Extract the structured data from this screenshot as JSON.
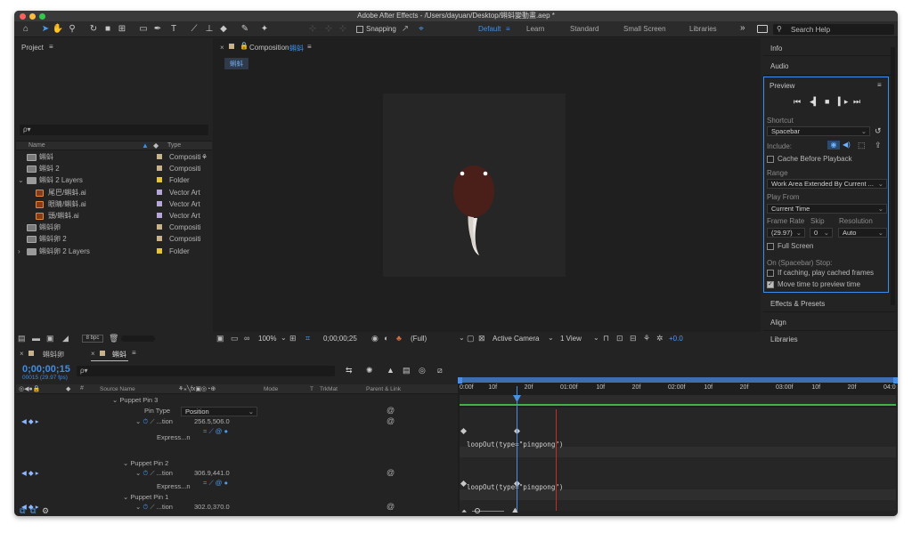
{
  "window": {
    "title": "Adobe After Effects - /Users/dayuan/Desktop/蝌蚪變動畫.aep *"
  },
  "toolbar": {
    "snapping_label": "Snapping",
    "workspaces": [
      "Default",
      "Learn",
      "Standard",
      "Small Screen",
      "Libraries"
    ],
    "active_workspace": "Default",
    "more_label": "»",
    "search_placeholder": "Search Help"
  },
  "project": {
    "title": "Project",
    "menu_icon": "≡",
    "search_prefix": "ρ▾",
    "col_name": "Name",
    "col_type": "Type",
    "items": [
      {
        "name": "蝌蚪",
        "type": "Compositi",
        "kind": "comp",
        "swatch": "#c9b38a"
      },
      {
        "name": "蝌蚪 2",
        "type": "Compositi",
        "kind": "comp",
        "swatch": "#c9b38a"
      },
      {
        "name": "蝌蚪 2 Layers",
        "type": "Folder",
        "kind": "folder",
        "swatch": "#e3c43a",
        "expanded": true
      },
      {
        "name": "尾巴/蝌蚪.ai",
        "type": "Vector Art",
        "kind": "ai",
        "swatch": "#b7a6d9",
        "indent": 1
      },
      {
        "name": "眼睛/蝌蚪.ai",
        "type": "Vector Art",
        "kind": "ai",
        "swatch": "#b7a6d9",
        "indent": 1
      },
      {
        "name": "頭/蝌蚪.ai",
        "type": "Vector Art",
        "kind": "ai",
        "swatch": "#b7a6d9",
        "indent": 1
      },
      {
        "name": "蝌蚪卵",
        "type": "Compositi",
        "kind": "comp",
        "swatch": "#c9b38a"
      },
      {
        "name": "蝌蚪卵 2",
        "type": "Compositi",
        "kind": "comp",
        "swatch": "#c9b38a"
      },
      {
        "name": "蝌蚪卵 2 Layers",
        "type": "Folder",
        "kind": "folder",
        "swatch": "#e3c43a"
      }
    ],
    "bpc_label": "8 bpc"
  },
  "composition": {
    "title": "Composition",
    "name": "蝌蚪",
    "tab_label": "蝌蚪",
    "zoom": "100%",
    "timecode": "0;00;00;25",
    "resolution": "(Full)",
    "camera": "Active Camera",
    "view": "1 View",
    "exposure": "+0.0"
  },
  "right_panels": {
    "info": "Info",
    "audio": "Audio",
    "preview": {
      "title": "Preview",
      "shortcut_label": "Shortcut",
      "shortcut_value": "Spacebar",
      "include_label": "Include:",
      "cache_label": "Cache Before Playback",
      "range_label": "Range",
      "range_value": "Work Area Extended By Current ...",
      "play_from_label": "Play From",
      "play_from_value": "Current Time",
      "frame_rate_label": "Frame Rate",
      "skip_label": "Skip",
      "resolution_label": "Resolution",
      "frame_rate_value": "(29.97)",
      "skip_value": "0",
      "resolution_value": "Auto",
      "full_screen_label": "Full Screen",
      "stop_label": "On (Spacebar) Stop:",
      "if_caching_label": "If caching, play cached frames",
      "move_time_label": "Move time to preview time",
      "move_time_checked": true
    },
    "effects": "Effects & Presets",
    "align": "Align",
    "libraries": "Libraries"
  },
  "timeline": {
    "tabs": [
      {
        "label": "蝌蚪卵",
        "active": false
      },
      {
        "label": "蝌蚪",
        "active": true
      }
    ],
    "timecode": "0;00;00;15",
    "frame_info": "00015 (29.97 fps)",
    "col_source": "Source Name",
    "col_mode": "Mode",
    "col_t": "T",
    "col_trkmat": "TrkMat",
    "col_parent": "Parent & Link",
    "ruler_labels": [
      "0:00f",
      "10f",
      "20f",
      "01:00f",
      "10f",
      "20f",
      "02:00f",
      "10f",
      "20f",
      "03:00f",
      "10f",
      "20f",
      "04:0"
    ],
    "layers": [
      {
        "label": "Puppet Pin 3",
        "pin_type_label": "Pin Type",
        "pin_type_value": "Position",
        "prop_label": "...tion",
        "value": "256.5,506.0",
        "expr_label": "Express...n",
        "expression": "loopOut(type=\"pingpong\")"
      },
      {
        "label": "Puppet Pin 2",
        "prop_label": "...tion",
        "value": "306.9,441.0",
        "expr_label": "Express...n",
        "expression": "loopOut(type=\"pingpong\")"
      },
      {
        "label": "Puppet Pin 1",
        "prop_label": "...tion",
        "value": "302.0,370.0"
      }
    ]
  },
  "colors": {
    "accent": "#3d8ee8",
    "value_red": "#e0453f",
    "work_area": "#3fb343",
    "playhead": "#4a90e2",
    "kf_red_line": "#c52b27"
  }
}
